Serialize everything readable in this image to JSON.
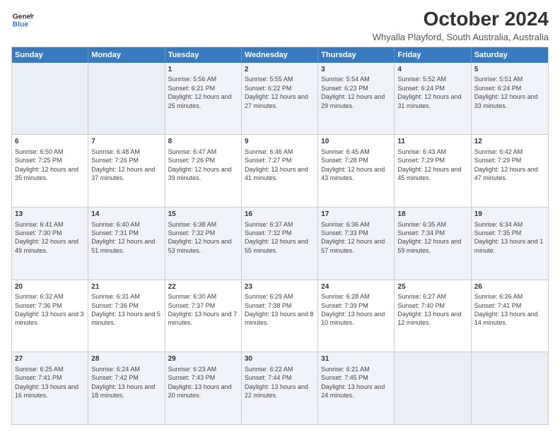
{
  "header": {
    "logo_line1": "General",
    "logo_line2": "Blue",
    "month": "October 2024",
    "location": "Whyalla Playford, South Australia, Australia"
  },
  "days_of_week": [
    "Sunday",
    "Monday",
    "Tuesday",
    "Wednesday",
    "Thursday",
    "Friday",
    "Saturday"
  ],
  "rows": [
    [
      {
        "day": "",
        "text": ""
      },
      {
        "day": "",
        "text": ""
      },
      {
        "day": "1",
        "text": "Sunrise: 5:56 AM\nSunset: 6:21 PM\nDaylight: 12 hours and 25 minutes."
      },
      {
        "day": "2",
        "text": "Sunrise: 5:55 AM\nSunset: 6:22 PM\nDaylight: 12 hours and 27 minutes."
      },
      {
        "day": "3",
        "text": "Sunrise: 5:54 AM\nSunset: 6:23 PM\nDaylight: 12 hours and 29 minutes."
      },
      {
        "day": "4",
        "text": "Sunrise: 5:52 AM\nSunset: 6:24 PM\nDaylight: 12 hours and 31 minutes."
      },
      {
        "day": "5",
        "text": "Sunrise: 5:51 AM\nSunset: 6:24 PM\nDaylight: 12 hours and 33 minutes."
      }
    ],
    [
      {
        "day": "6",
        "text": "Sunrise: 6:50 AM\nSunset: 7:25 PM\nDaylight: 12 hours and 35 minutes."
      },
      {
        "day": "7",
        "text": "Sunrise: 6:48 AM\nSunset: 7:26 PM\nDaylight: 12 hours and 37 minutes."
      },
      {
        "day": "8",
        "text": "Sunrise: 6:47 AM\nSunset: 7:26 PM\nDaylight: 12 hours and 39 minutes."
      },
      {
        "day": "9",
        "text": "Sunrise: 6:46 AM\nSunset: 7:27 PM\nDaylight: 12 hours and 41 minutes."
      },
      {
        "day": "10",
        "text": "Sunrise: 6:45 AM\nSunset: 7:28 PM\nDaylight: 12 hours and 43 minutes."
      },
      {
        "day": "11",
        "text": "Sunrise: 6:43 AM\nSunset: 7:29 PM\nDaylight: 12 hours and 45 minutes."
      },
      {
        "day": "12",
        "text": "Sunrise: 6:42 AM\nSunset: 7:29 PM\nDaylight: 12 hours and 47 minutes."
      }
    ],
    [
      {
        "day": "13",
        "text": "Sunrise: 6:41 AM\nSunset: 7:30 PM\nDaylight: 12 hours and 49 minutes."
      },
      {
        "day": "14",
        "text": "Sunrise: 6:40 AM\nSunset: 7:31 PM\nDaylight: 12 hours and 51 minutes."
      },
      {
        "day": "15",
        "text": "Sunrise: 6:38 AM\nSunset: 7:32 PM\nDaylight: 12 hours and 53 minutes."
      },
      {
        "day": "16",
        "text": "Sunrise: 6:37 AM\nSunset: 7:32 PM\nDaylight: 12 hours and 55 minutes."
      },
      {
        "day": "17",
        "text": "Sunrise: 6:36 AM\nSunset: 7:33 PM\nDaylight: 12 hours and 57 minutes."
      },
      {
        "day": "18",
        "text": "Sunrise: 6:35 AM\nSunset: 7:34 PM\nDaylight: 12 hours and 59 minutes."
      },
      {
        "day": "19",
        "text": "Sunrise: 6:34 AM\nSunset: 7:35 PM\nDaylight: 13 hours and 1 minute."
      }
    ],
    [
      {
        "day": "20",
        "text": "Sunrise: 6:32 AM\nSunset: 7:36 PM\nDaylight: 13 hours and 3 minutes."
      },
      {
        "day": "21",
        "text": "Sunrise: 6:31 AM\nSunset: 7:36 PM\nDaylight: 13 hours and 5 minutes."
      },
      {
        "day": "22",
        "text": "Sunrise: 6:30 AM\nSunset: 7:37 PM\nDaylight: 13 hours and 7 minutes."
      },
      {
        "day": "23",
        "text": "Sunrise: 6:29 AM\nSunset: 7:38 PM\nDaylight: 13 hours and 8 minutes."
      },
      {
        "day": "24",
        "text": "Sunrise: 6:28 AM\nSunset: 7:39 PM\nDaylight: 13 hours and 10 minutes."
      },
      {
        "day": "25",
        "text": "Sunrise: 6:27 AM\nSunset: 7:40 PM\nDaylight: 13 hours and 12 minutes."
      },
      {
        "day": "26",
        "text": "Sunrise: 6:26 AM\nSunset: 7:41 PM\nDaylight: 13 hours and 14 minutes."
      }
    ],
    [
      {
        "day": "27",
        "text": "Sunrise: 6:25 AM\nSunset: 7:41 PM\nDaylight: 13 hours and 16 minutes."
      },
      {
        "day": "28",
        "text": "Sunrise: 6:24 AM\nSunset: 7:42 PM\nDaylight: 13 hours and 18 minutes."
      },
      {
        "day": "29",
        "text": "Sunrise: 6:23 AM\nSunset: 7:43 PM\nDaylight: 13 hours and 20 minutes."
      },
      {
        "day": "30",
        "text": "Sunrise: 6:22 AM\nSunset: 7:44 PM\nDaylight: 13 hours and 22 minutes."
      },
      {
        "day": "31",
        "text": "Sunrise: 6:21 AM\nSunset: 7:45 PM\nDaylight: 13 hours and 24 minutes."
      },
      {
        "day": "",
        "text": ""
      },
      {
        "day": "",
        "text": ""
      }
    ]
  ],
  "alt_rows": [
    0,
    2,
    4
  ]
}
